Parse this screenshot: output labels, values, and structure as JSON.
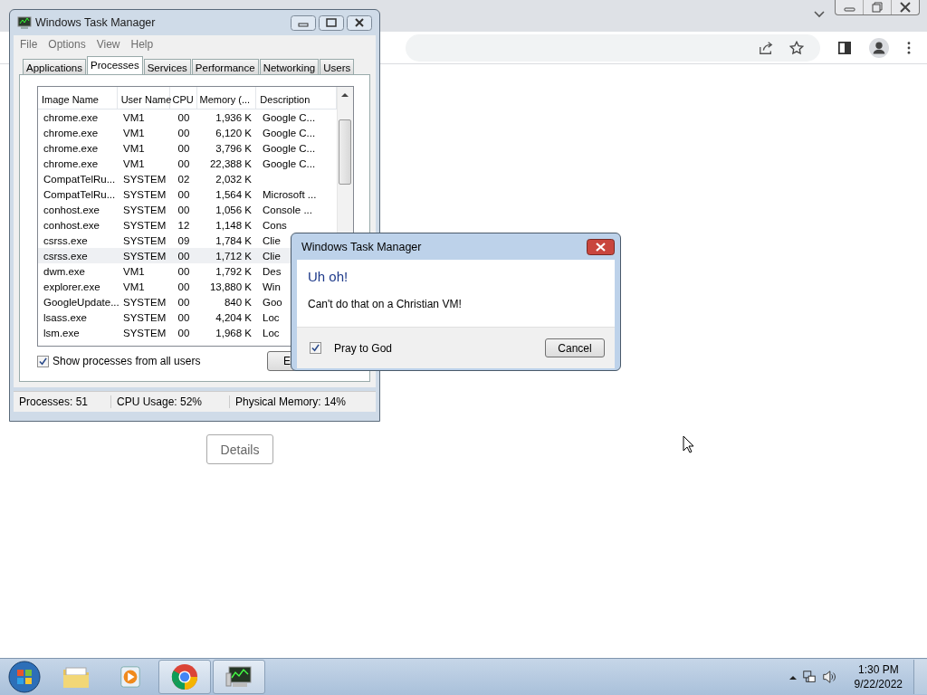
{
  "browser": {
    "details_button": "Details"
  },
  "task_manager": {
    "title": "Windows Task Manager",
    "menu": [
      "File",
      "Options",
      "View",
      "Help"
    ],
    "tabs": [
      {
        "label": "Applications",
        "selected": false
      },
      {
        "label": "Processes",
        "selected": true
      },
      {
        "label": "Services",
        "selected": false
      },
      {
        "label": "Performance",
        "selected": false
      },
      {
        "label": "Networking",
        "selected": false
      },
      {
        "label": "Users",
        "selected": false
      }
    ],
    "columns": [
      "Image Name",
      "User Name",
      "CPU",
      "Memory (...",
      "Description"
    ],
    "rows": [
      {
        "cells": [
          "chrome.exe",
          "VM1",
          "00",
          "1,936 K",
          "Google C..."
        ],
        "selected": false
      },
      {
        "cells": [
          "chrome.exe",
          "VM1",
          "00",
          "6,120 K",
          "Google C..."
        ],
        "selected": false
      },
      {
        "cells": [
          "chrome.exe",
          "VM1",
          "00",
          "3,796 K",
          "Google C..."
        ],
        "selected": false
      },
      {
        "cells": [
          "chrome.exe",
          "VM1",
          "00",
          "22,388 K",
          "Google C..."
        ],
        "selected": false
      },
      {
        "cells": [
          "CompatTelRu...",
          "SYSTEM",
          "02",
          "2,032 K",
          ""
        ],
        "selected": false
      },
      {
        "cells": [
          "CompatTelRu...",
          "SYSTEM",
          "00",
          "1,564 K",
          "Microsoft ..."
        ],
        "selected": false
      },
      {
        "cells": [
          "conhost.exe",
          "SYSTEM",
          "00",
          "1,056 K",
          "Console ..."
        ],
        "selected": false
      },
      {
        "cells": [
          "conhost.exe",
          "SYSTEM",
          "12",
          "1,148 K",
          "Cons"
        ],
        "selected": false
      },
      {
        "cells": [
          "csrss.exe",
          "SYSTEM",
          "09",
          "1,784 K",
          "Clie"
        ],
        "selected": false
      },
      {
        "cells": [
          "csrss.exe",
          "SYSTEM",
          "00",
          "1,712 K",
          "Clie"
        ],
        "selected": true
      },
      {
        "cells": [
          "dwm.exe",
          "VM1",
          "00",
          "1,792 K",
          "Des"
        ],
        "selected": false
      },
      {
        "cells": [
          "explorer.exe",
          "VM1",
          "00",
          "13,880 K",
          "Win"
        ],
        "selected": false
      },
      {
        "cells": [
          "GoogleUpdate...",
          "SYSTEM",
          "00",
          "840 K",
          "Goo"
        ],
        "selected": false
      },
      {
        "cells": [
          "lsass.exe",
          "SYSTEM",
          "00",
          "4,204 K",
          "Loc"
        ],
        "selected": false
      },
      {
        "cells": [
          "lsm.exe",
          "SYSTEM",
          "00",
          "1,968 K",
          "Loc"
        ],
        "selected": false
      }
    ],
    "show_all_users": {
      "label": "Show processes from all users",
      "checked": true
    },
    "end_button": "E",
    "status_bar": [
      "Processes: 51",
      "CPU Usage: 52%",
      "Physical Memory: 14%"
    ]
  },
  "dialog": {
    "title": "Windows Task Manager",
    "heading": "Uh oh!",
    "message": "Can't do that on a Christian VM!",
    "checkbox": {
      "label": "Pray to God",
      "checked": true
    },
    "button": "Cancel"
  },
  "taskbar": {
    "time": "1:30 PM",
    "date": "9/22/2022"
  }
}
